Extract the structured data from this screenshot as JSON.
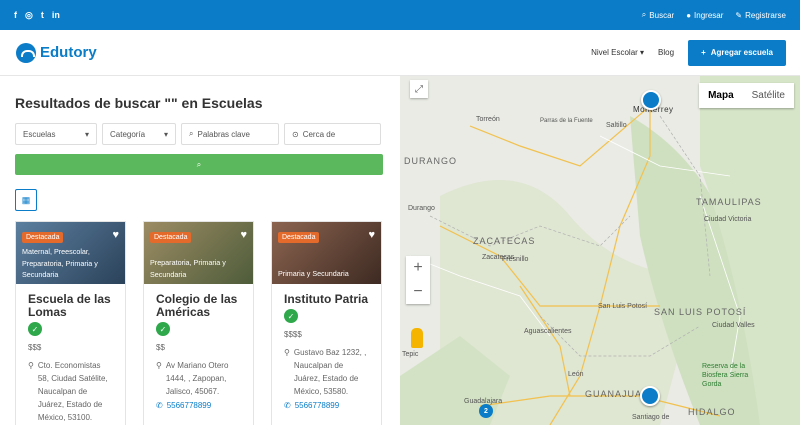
{
  "topbar": {
    "social": [
      "f",
      "◎",
      "t",
      "in"
    ],
    "links": [
      {
        "icon": "search-icon",
        "glyph": "⌕",
        "label": "Buscar"
      },
      {
        "icon": "user-icon",
        "glyph": "●",
        "label": "Ingresar"
      },
      {
        "icon": "pencil-icon",
        "glyph": "✎",
        "label": "Registrarse"
      }
    ]
  },
  "nav": {
    "brand": "Edutory",
    "items": [
      "Nivel Escolar ▾",
      "Blog"
    ],
    "add_label": "Agregar escuela"
  },
  "results": {
    "heading": "Resultados de buscar \"\" en Escuelas",
    "filters": {
      "type": "Escuelas",
      "category": "Categoría",
      "keywords_placeholder": "Palabras clave",
      "near_placeholder": "Cerca de"
    }
  },
  "cards": [
    {
      "badge": "Destacada",
      "categories": "Maternal, Preescolar, Preparatoria, Primaria y Secundaria",
      "title": "Escuela de las Lomas",
      "price": "$$$",
      "address": "Cto. Economistas 58, Ciudad Satélite, Naucalpan de Juárez, Estado de México, 53100.",
      "phone": "",
      "img_color": "#3a5a7a"
    },
    {
      "badge": "Destacada",
      "categories": "Preparatoria, Primaria y Secundaria",
      "title": "Colegio de las Américas",
      "price": "$$",
      "address": "Av Mariano Otero 1444, , Zapopan, Jalisco, 45067.",
      "phone": "5566778899",
      "img_color": "#7a6a4a"
    },
    {
      "badge": "Destacada",
      "categories": "Primaria y Secundaria",
      "title": "Instituto Patria",
      "price": "$$$$",
      "address": "Gustavo Baz 1232, , Naucalpan de Juárez, Estado de México, 53580.",
      "phone": "5566778899",
      "img_color": "#6a4a3a"
    }
  ],
  "map": {
    "type_options": [
      "Mapa",
      "Satélite"
    ],
    "selected_type": "Mapa",
    "labels": [
      "Monterrey",
      "Torreón",
      "Saltillo",
      "Parras de la Fuente",
      "Durango",
      "DURANGO",
      "TAMAULIPAS",
      "Ciudad Victoria",
      "ZACATECAS",
      "Zacatecas",
      "Fresnillo",
      "San Luis Potosí",
      "SAN LUIS POTOSÍ",
      "Aguascalientes",
      "Tepic",
      "León",
      "GUANAJUATO",
      "Guadalajara",
      "Santiago de",
      "HIDALGO",
      "Reserva de la Biosfera Sierra Gorda",
      "Ciudad Valles"
    ],
    "cluster_count": "2"
  }
}
